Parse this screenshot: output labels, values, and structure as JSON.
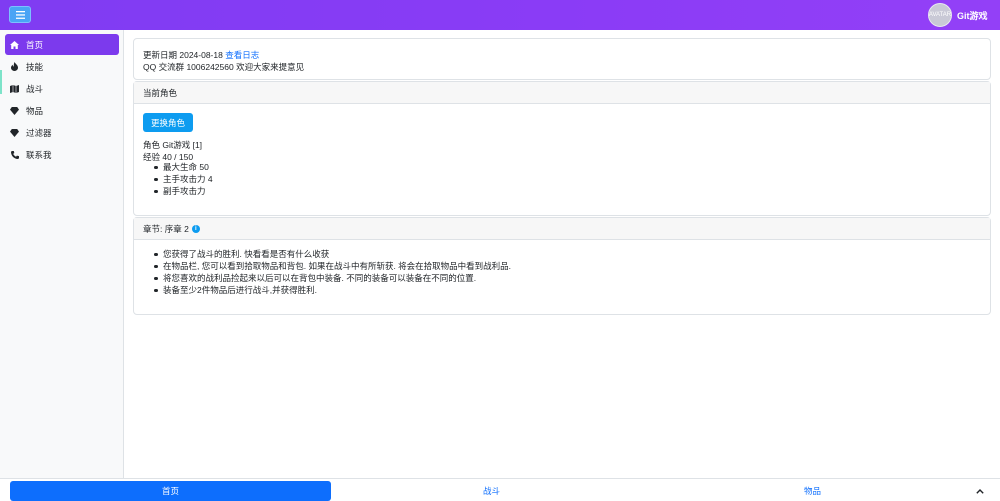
{
  "header": {
    "menu_icon": "hamburger-icon",
    "avatar_text": "AVATAR",
    "username": "Git游戏"
  },
  "sidebar": {
    "items": [
      {
        "label": "首页",
        "icon": "home-icon",
        "active": true
      },
      {
        "label": "技能",
        "icon": "fire-icon",
        "active": false
      },
      {
        "label": "战斗",
        "icon": "map-icon",
        "active": false
      },
      {
        "label": "物品",
        "icon": "gem-icon",
        "active": false
      },
      {
        "label": "过滤器",
        "icon": "gem-icon",
        "active": false
      },
      {
        "label": "联系我",
        "icon": "phone-icon",
        "active": false
      }
    ]
  },
  "update": {
    "prefix": "更新日期 2024-08-18",
    "log_link": "查看日志",
    "qq_line": "QQ 交流群 1006242560 欢迎大家来提意见"
  },
  "character": {
    "header": "当前角色",
    "change_button": "更换角色",
    "role_line": "角色 Git游戏 [1]",
    "exp_line": "经验 40 / 150",
    "stats": [
      "最大生命 50",
      "主手攻击力 4",
      "副手攻击力"
    ]
  },
  "chapter": {
    "header": "章节: 序章 2",
    "info_icon": "info-icon",
    "tips": [
      "您获得了战斗的胜利. 快看看是否有什么收获",
      "在物品栏, 您可以看到拾取物品和背包. 如果在战斗中有所斩获. 将会在拾取物品中看到战利品.",
      "将您喜欢的战利品捡起来以后可以在背包中装备. 不同的装备可以装备在不同的位置.",
      "装备至少2件物品后进行战斗,并获得胜利."
    ]
  },
  "bottom_nav": {
    "tabs": [
      {
        "label": "首页",
        "active": true
      },
      {
        "label": "战斗",
        "active": false
      },
      {
        "label": "物品",
        "active": false
      }
    ],
    "collapse_icon": "chevron-up-icon"
  },
  "colors": {
    "header_gradient_start": "#7f3cf2",
    "header_gradient_end": "#9340f7",
    "sidebar_active": "#7c3aed",
    "primary": "#0d6efd",
    "info": "#0d9cf0"
  }
}
